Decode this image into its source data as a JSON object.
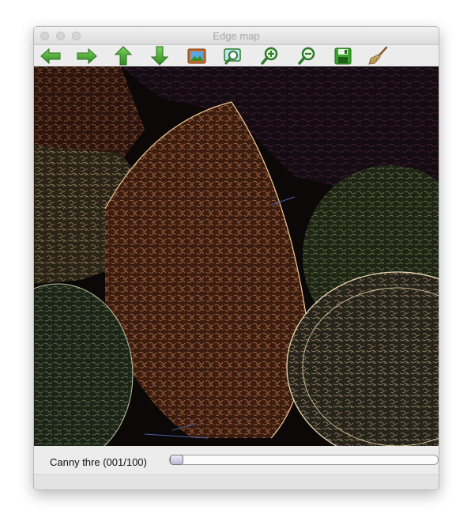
{
  "window": {
    "title": "Edge map"
  },
  "toolbar": {
    "buttons": [
      {
        "name": "back",
        "icon": "arrow-left-icon",
        "tooltip": "Back"
      },
      {
        "name": "forward",
        "icon": "arrow-right-icon",
        "tooltip": "Forward"
      },
      {
        "name": "up",
        "icon": "arrow-up-icon",
        "tooltip": "Up"
      },
      {
        "name": "down",
        "icon": "arrow-down-icon",
        "tooltip": "Down"
      },
      {
        "name": "image",
        "icon": "picture-icon",
        "tooltip": "Image"
      },
      {
        "name": "zoom-fit",
        "icon": "zoom-fit-icon",
        "tooltip": "Zoom fit"
      },
      {
        "name": "zoom-in",
        "icon": "zoom-in-icon",
        "tooltip": "Zoom in"
      },
      {
        "name": "zoom-out",
        "icon": "zoom-out-icon",
        "tooltip": "Zoom out"
      },
      {
        "name": "save",
        "icon": "floppy-save-icon",
        "tooltip": "Save"
      },
      {
        "name": "clear",
        "icon": "broom-icon",
        "tooltip": "Clear"
      }
    ],
    "accent": "#3aa52e"
  },
  "image_view": {
    "content": "edge-map-image",
    "description_color": "#0c0808"
  },
  "trackbar": {
    "label": "Canny thre (001/100)",
    "value": 1,
    "max": 100
  }
}
